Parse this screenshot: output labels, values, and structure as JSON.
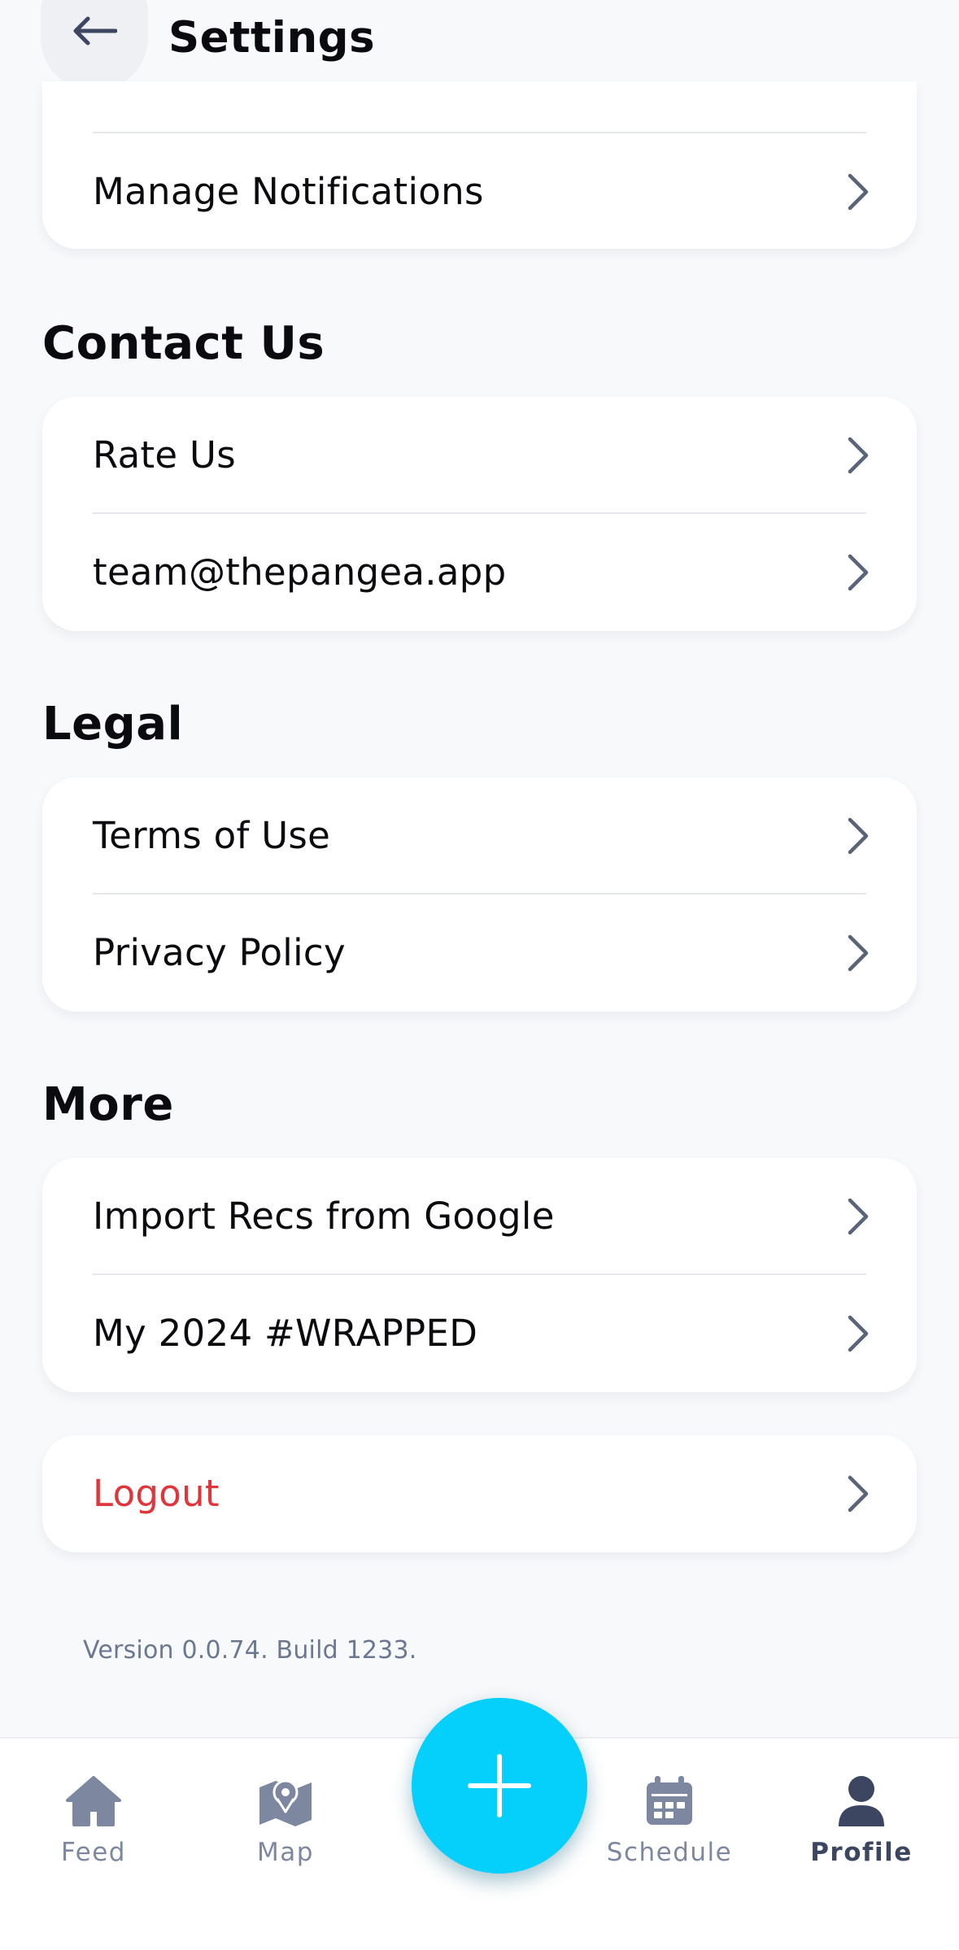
{
  "header": {
    "title": "Settings"
  },
  "notifications_card": {
    "items": [
      {
        "label": "Manage Notifications"
      }
    ]
  },
  "contact": {
    "title": "Contact Us",
    "items": [
      {
        "label": "Rate Us"
      },
      {
        "label": "team@thepangea.app"
      }
    ]
  },
  "legal": {
    "title": "Legal",
    "items": [
      {
        "label": "Terms of Use"
      },
      {
        "label": "Privacy Policy"
      }
    ]
  },
  "more": {
    "title": "More",
    "items": [
      {
        "label": "Import Recs from Google"
      },
      {
        "label": "My 2024 #WRAPPED"
      }
    ]
  },
  "logout": {
    "label": "Logout"
  },
  "version_text": "Version 0.0.74. Build 1233.",
  "tabbar": {
    "tabs": [
      {
        "label": "Feed",
        "icon": "home-icon"
      },
      {
        "label": "Map",
        "icon": "map-icon"
      },
      {
        "label": "Schedule",
        "icon": "calendar-icon"
      },
      {
        "label": "Profile",
        "icon": "person-icon",
        "active": true
      }
    ],
    "fab_icon": "plus-icon"
  },
  "colors": {
    "accent": "#05cffb",
    "danger": "#e0353b",
    "background": "#f8f9fb",
    "icon_muted": "#7d88a0",
    "icon_active": "#3d4661"
  }
}
